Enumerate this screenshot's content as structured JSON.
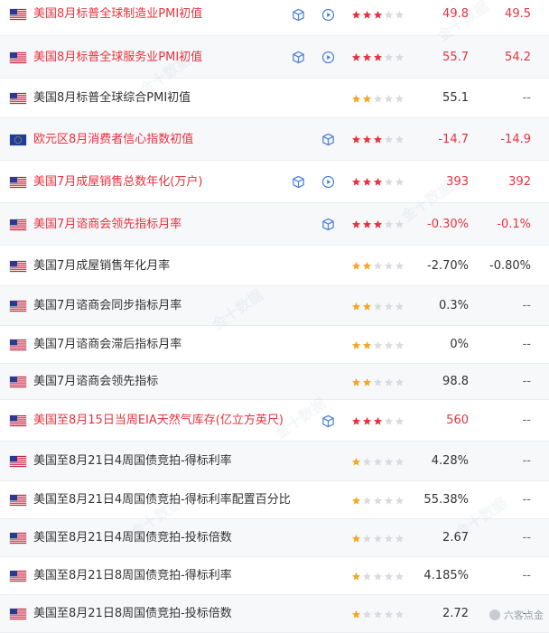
{
  "colors": {
    "highlight": "#e8323e",
    "star_on": "#e8323e",
    "star_low": "#f5a623",
    "star_off": "#d9dbe0",
    "icon_blue": "#4a7fd8"
  },
  "rows": [
    {
      "flag": "us",
      "name": "美国8月标普全球制造业PMI初值",
      "hi": true,
      "cube": true,
      "play": true,
      "stars": 3,
      "actual": "49.8",
      "prev": "49.5",
      "actual_hi": true,
      "prev_hi": true
    },
    {
      "flag": "us",
      "name": "美国8月标普全球服务业PMI初值",
      "hi": true,
      "cube": true,
      "play": true,
      "stars": 3,
      "actual": "55.7",
      "prev": "54.2",
      "actual_hi": true,
      "prev_hi": true
    },
    {
      "flag": "us",
      "name": "美国8月标普全球综合PMI初值",
      "hi": false,
      "cube": false,
      "play": false,
      "stars": 2,
      "actual": "55.1",
      "prev": "--",
      "actual_hi": false,
      "prev_hi": false
    },
    {
      "flag": "eu",
      "name": "欧元区8月消费者信心指数初值",
      "hi": true,
      "cube": true,
      "play": false,
      "stars": 3,
      "actual": "-14.7",
      "prev": "-14.9",
      "actual_hi": true,
      "prev_hi": true
    },
    {
      "flag": "us",
      "name": "美国7月成屋销售总数年化(万户)",
      "hi": true,
      "cube": true,
      "play": true,
      "stars": 3,
      "actual": "393",
      "prev": "392",
      "actual_hi": true,
      "prev_hi": true
    },
    {
      "flag": "us",
      "name": "美国7月谘商会领先指标月率",
      "hi": true,
      "cube": true,
      "play": false,
      "stars": 3,
      "actual": "-0.30%",
      "prev": "-0.1%",
      "actual_hi": true,
      "prev_hi": true
    },
    {
      "flag": "us",
      "name": "美国7月成屋销售年化月率",
      "hi": false,
      "cube": false,
      "play": false,
      "stars": 2,
      "actual": "-2.70%",
      "prev": "-0.80%",
      "actual_hi": false,
      "prev_hi": false
    },
    {
      "flag": "us",
      "name": "美国7月谘商会同步指标月率",
      "hi": false,
      "cube": false,
      "play": false,
      "stars": 2,
      "actual": "0.3%",
      "prev": "--",
      "actual_hi": false,
      "prev_hi": false
    },
    {
      "flag": "us",
      "name": "美国7月谘商会滞后指标月率",
      "hi": false,
      "cube": false,
      "play": false,
      "stars": 2,
      "actual": "0%",
      "prev": "--",
      "actual_hi": false,
      "prev_hi": false
    },
    {
      "flag": "us",
      "name": "美国7月谘商会领先指标",
      "hi": false,
      "cube": false,
      "play": false,
      "stars": 2,
      "actual": "98.8",
      "prev": "--",
      "actual_hi": false,
      "prev_hi": false
    },
    {
      "flag": "us",
      "name": "美国至8月15日当周EIA天然气库存(亿立方英尺)",
      "hi": true,
      "cube": true,
      "play": false,
      "stars": 3,
      "actual": "560",
      "prev": "--",
      "actual_hi": true,
      "prev_hi": false
    },
    {
      "flag": "us",
      "name": "美国至8月21日4周国债竞拍-得标利率",
      "hi": false,
      "cube": false,
      "play": false,
      "stars": 1,
      "actual": "4.28%",
      "prev": "--",
      "actual_hi": false,
      "prev_hi": false
    },
    {
      "flag": "us",
      "name": "美国至8月21日4周国债竞拍-得标利率配置百分比",
      "hi": false,
      "cube": false,
      "play": false,
      "stars": 1,
      "actual": "55.38%",
      "prev": "--",
      "actual_hi": false,
      "prev_hi": false
    },
    {
      "flag": "us",
      "name": "美国至8月21日4周国债竞拍-投标倍数",
      "hi": false,
      "cube": false,
      "play": false,
      "stars": 1,
      "actual": "2.67",
      "prev": "--",
      "actual_hi": false,
      "prev_hi": false
    },
    {
      "flag": "us",
      "name": "美国至8月21日8周国债竞拍-得标利率",
      "hi": false,
      "cube": false,
      "play": false,
      "stars": 1,
      "actual": "4.185%",
      "prev": "--",
      "actual_hi": false,
      "prev_hi": false
    },
    {
      "flag": "us",
      "name": "美国至8月21日8周国债竞拍-投标倍数",
      "hi": false,
      "cube": false,
      "play": false,
      "stars": 1,
      "actual": "2.72",
      "prev": "--",
      "actual_hi": false,
      "prev_hi": false
    }
  ],
  "watermark": "金十数据",
  "footer_brand": "六客点金"
}
